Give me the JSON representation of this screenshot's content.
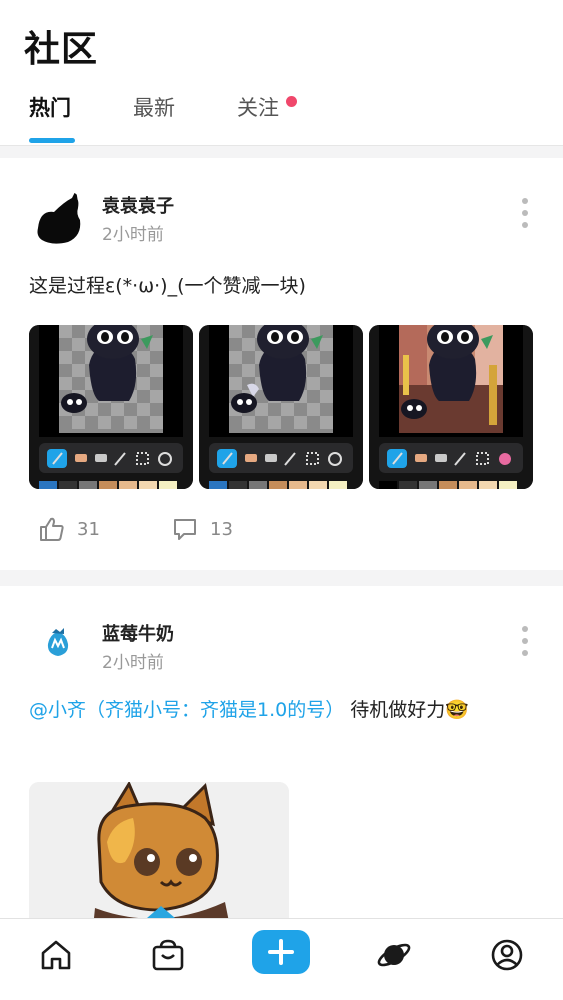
{
  "header": {
    "title": "社区",
    "tabs": [
      {
        "label": "热门",
        "active": true
      },
      {
        "label": "最新",
        "active": false
      },
      {
        "label": "关注",
        "active": false,
        "has_notification_dot": true
      }
    ]
  },
  "posts": [
    {
      "author": "袁袁袁子",
      "time": "2小时前",
      "text": "这是过程ε(*·ω·)_(一个赞减一块)",
      "images": [
        "process-step-1",
        "process-step-2",
        "process-step-3"
      ],
      "likes": "31",
      "comments": "13"
    },
    {
      "author": "蓝莓牛奶",
      "time": "2小时前",
      "mention": "@小齐（齐猫小号：齐猫是1.0的号）",
      "text": " 待机做好力🤓",
      "images": [
        "pixel-cat-art"
      ]
    }
  ],
  "bottom_nav": {
    "items": [
      "home-icon",
      "shop-icon",
      "add-icon",
      "planet-icon",
      "profile-icon"
    ]
  },
  "colors": {
    "accent": "#1fa3e8",
    "notification_dot": "#f0476b"
  }
}
